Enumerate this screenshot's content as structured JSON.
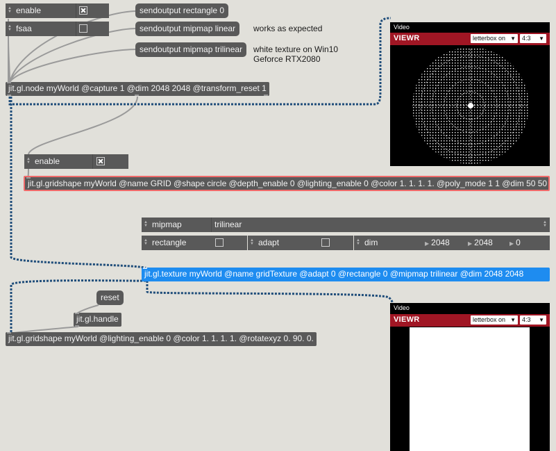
{
  "top_toggles": [
    {
      "label": "enable",
      "checked": true
    },
    {
      "label": "fsaa",
      "checked": false
    }
  ],
  "messages": {
    "rect0": "sendoutput rectangle 0",
    "linear": "sendoutput mipmap linear",
    "trilinear": "sendoutput mipmap trilinear",
    "reset": "reset"
  },
  "comments": {
    "works": "works as expected",
    "white_line1": "white texture on Win10",
    "white_line2": "Geforce RTX2080"
  },
  "objects": {
    "node": "jit.gl.node myWorld @capture 1 @dim 2048 2048 @transform_reset 1",
    "grid": "jit.gl.gridshape myWorld @name GRID @shape circle @depth_enable 0 @lighting_enable 0 @color 1. 1. 1. 1. @poly_mode 1 1 @dim 50 50",
    "texture": "jit.gl.texture myWorld @name gridTexture @adapt 0 @rectangle 0 @mipmap trilinear @dim 2048 2048",
    "handle": "jit.gl.handle",
    "gridshape2": "jit.gl.gridshape myWorld @lighting_enable 0 @color 1. 1. 1. 1. @rotatexyz 0. 90. 0."
  },
  "grid_toggle": {
    "label": "enable",
    "checked": true
  },
  "attrui": {
    "mipmap_label": "mipmap",
    "mipmap_value": "trilinear",
    "rectangle_label": "rectangle",
    "rectangle_checked": false,
    "adapt_label": "adapt",
    "adapt_checked": false,
    "dim_label": "dim",
    "dim_values": [
      "2048",
      "2048",
      "0"
    ]
  },
  "video_windows": [
    {
      "title": "Video",
      "brand": "VIEWR",
      "letterbox": "letterbox on",
      "aspect": "4:3",
      "content": "circle-grid"
    },
    {
      "title": "Video",
      "brand": "VIEWR",
      "letterbox": "letterbox on",
      "aspect": "4:3",
      "content": "white-texture"
    }
  ],
  "colors": {
    "patch_bg": "#e1e0da",
    "object_bg": "#595959",
    "selected_object": "#1e8cf0",
    "gridshape_outline": "#f06a6a",
    "viewer_bar": "#a01624",
    "cord_dark": "#1f4d7a",
    "cord_grey": "#9a9a9a"
  }
}
